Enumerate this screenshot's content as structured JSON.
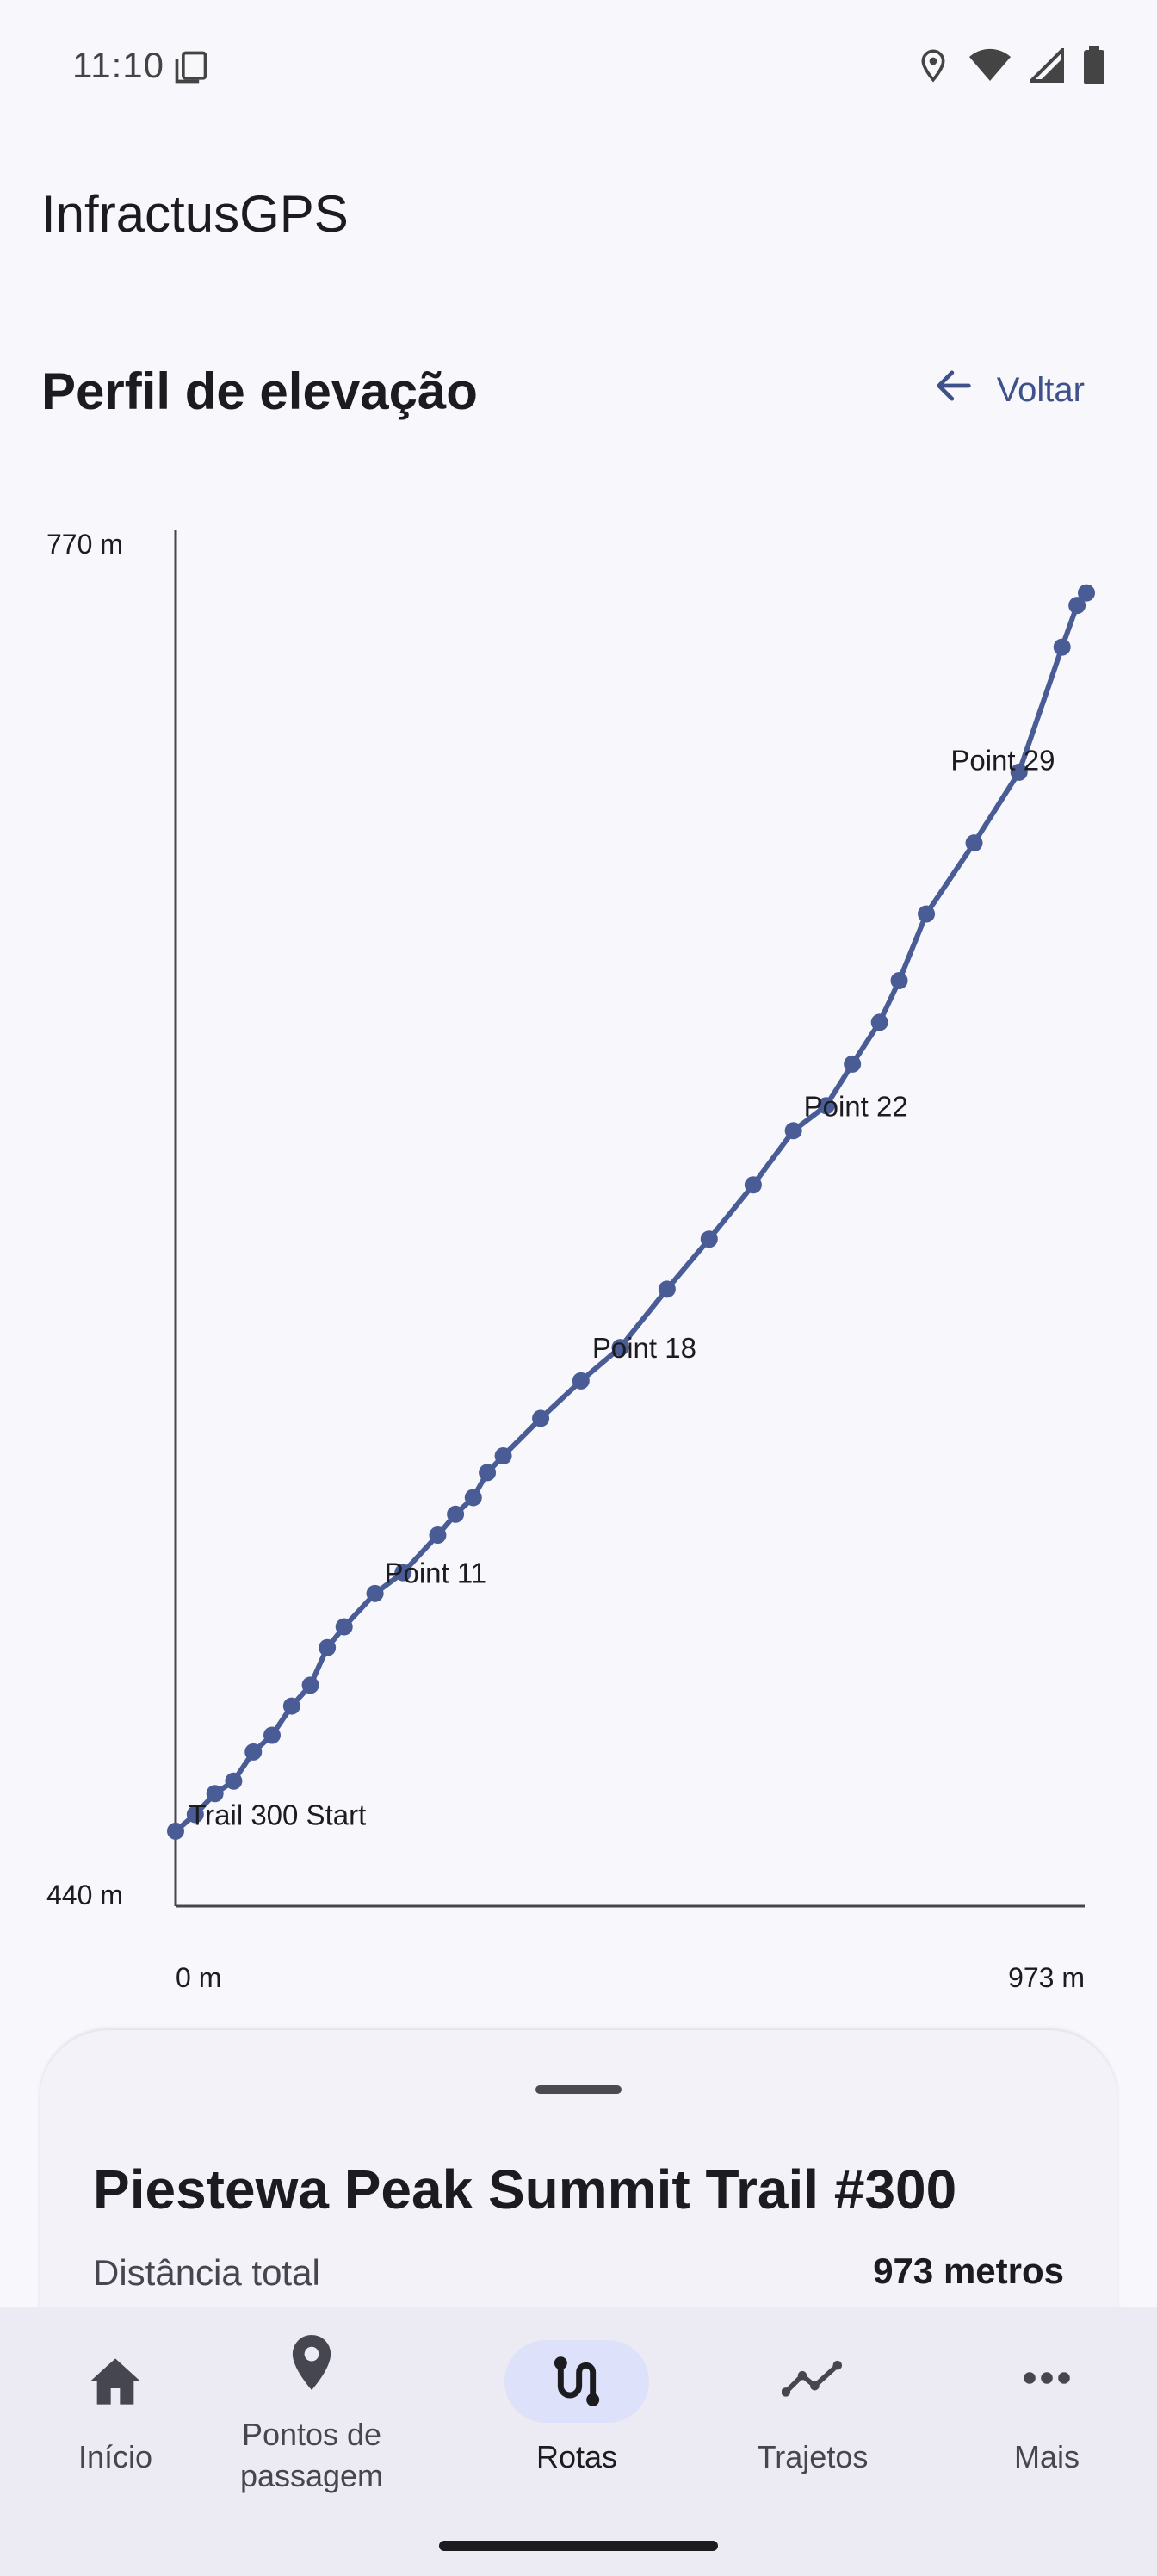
{
  "status_bar": {
    "time": "11:10",
    "icons": [
      "notes-icon",
      "location-icon",
      "wifi-icon",
      "signal-icon",
      "battery-icon"
    ]
  },
  "app": {
    "title": "InfractusGPS"
  },
  "header": {
    "title": "Perfil de elevação",
    "back_label": "Voltar",
    "back_icon": "arrow-left-icon"
  },
  "colors": {
    "accent": "#4a5c96",
    "nav_active_pill": "#dde1f9",
    "text_primary": "#1c1b1f"
  },
  "chart_data": {
    "type": "line",
    "y_axis_labels": {
      "min": "440 m",
      "max": "770 m"
    },
    "x_axis_labels": {
      "min": "0 m",
      "max": "973 m"
    },
    "xlim": [
      0,
      973
    ],
    "ylim": [
      440,
      770
    ],
    "series": [
      {
        "points": [
          [
            0,
            458
          ],
          [
            21,
            462
          ],
          [
            42,
            467
          ],
          [
            62,
            470
          ],
          [
            83,
            477
          ],
          [
            103,
            481
          ],
          [
            124,
            488
          ],
          [
            144,
            493
          ],
          [
            162,
            502
          ],
          [
            180,
            507
          ],
          [
            213,
            515
          ],
          [
            243,
            520
          ],
          [
            280,
            529
          ],
          [
            299,
            534
          ],
          [
            318,
            538
          ],
          [
            333,
            544
          ],
          [
            350,
            548
          ],
          [
            390,
            557
          ],
          [
            433,
            566
          ],
          [
            475,
            574
          ],
          [
            525,
            588
          ],
          [
            570,
            600
          ],
          [
            617,
            613
          ],
          [
            660,
            626
          ],
          [
            695,
            632
          ],
          [
            723,
            642
          ],
          [
            752,
            652
          ],
          [
            773,
            662
          ],
          [
            802,
            678
          ],
          [
            853,
            695
          ],
          [
            901,
            712
          ],
          [
            947,
            742
          ],
          [
            963,
            752
          ],
          [
            973,
            755
          ]
        ]
      }
    ],
    "annotations": [
      {
        "label": "Trail 300 Start",
        "x": 14,
        "y": 462
      },
      {
        "label": "Point 11",
        "x": 223,
        "y": 520
      },
      {
        "label": "Point 18",
        "x": 445,
        "y": 574
      },
      {
        "label": "Point 22",
        "x": 671,
        "y": 632
      },
      {
        "label": "Point 29",
        "x": 828,
        "y": 715
      }
    ],
    "grid": false
  },
  "route": {
    "name": "Piestewa Peak Summit Trail #300",
    "distance_label": "Distância total",
    "distance_value": "973 metros"
  },
  "bottom_nav": {
    "items": [
      {
        "label": "Início",
        "icon": "home-icon",
        "active": false
      },
      {
        "label": "Pontos de passagem",
        "icon": "location-pin-icon",
        "active": false
      },
      {
        "label": "Rotas",
        "icon": "route-icon",
        "active": true
      },
      {
        "label": "Trajetos",
        "icon": "trend-line-icon",
        "active": false
      },
      {
        "label": "Mais",
        "icon": "more-horizontal-icon",
        "active": false
      }
    ]
  }
}
